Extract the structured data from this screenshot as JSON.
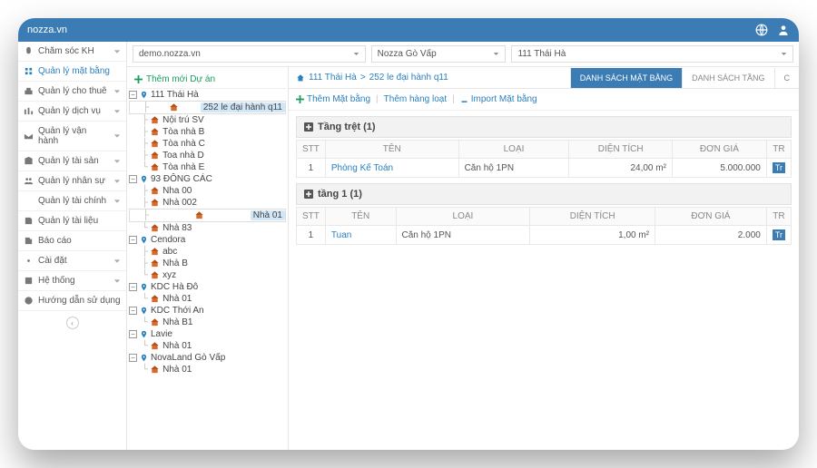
{
  "topbar": {
    "brand": "nozza.vn"
  },
  "sidebar": {
    "items": [
      {
        "label": "Chăm sóc KH",
        "chev": true
      },
      {
        "label": "Quản lý mặt bằng",
        "active": true
      },
      {
        "label": "Quản lý cho thuê",
        "chev": true
      },
      {
        "label": "Quản lý dịch vụ",
        "chev": true
      },
      {
        "label": "Quản lý vận hành",
        "chev": true
      },
      {
        "label": "Quản lý tài sản",
        "chev": true
      },
      {
        "label": "Quản lý nhân sự",
        "chev": true
      },
      {
        "label": "Quản lý tài chính",
        "chev": true
      },
      {
        "label": "Quản lý tài liệu"
      },
      {
        "label": "Báo cáo"
      },
      {
        "label": "Cài đặt",
        "chev": true
      },
      {
        "label": "Hệ thống",
        "chev": true
      },
      {
        "label": "Hướng dẫn sử dụng"
      }
    ]
  },
  "selects": {
    "domain": "demo.nozza.vn",
    "area": "Nozza Gò Vấp",
    "building": "111 Thái Hà"
  },
  "tree": {
    "add_project": "Thêm mới Dự án",
    "nodes": [
      {
        "name": "111 Thái Hà",
        "pin": true,
        "children": [
          {
            "name": "252 le đại hành q11",
            "selected": true
          },
          {
            "name": "Nội trú SV"
          },
          {
            "name": "Tòa nhà B"
          },
          {
            "name": "Tòa nhà C"
          },
          {
            "name": "Toa nhà D"
          },
          {
            "name": "Tòa nhà E"
          }
        ]
      },
      {
        "name": "93 ĐÔNG CÁC",
        "pin": true,
        "children": [
          {
            "name": "Nha 00"
          },
          {
            "name": "Nhà 002"
          },
          {
            "name": "Nhà 01",
            "selected": true
          },
          {
            "name": "Nhà 83"
          }
        ]
      },
      {
        "name": "Cendora",
        "pin": true,
        "children": [
          {
            "name": "abc"
          },
          {
            "name": "Nhà B"
          },
          {
            "name": "xyz"
          }
        ]
      },
      {
        "name": "KDC Hà Đô",
        "pin": true,
        "children": [
          {
            "name": "Nhà 01"
          }
        ]
      },
      {
        "name": "KDC Thới An",
        "pin": true,
        "children": [
          {
            "name": "Nhà B1"
          }
        ]
      },
      {
        "name": "Lavie",
        "pin": true,
        "children": [
          {
            "name": "Nhà 01"
          }
        ]
      },
      {
        "name": "NovaLand Gò Vấp",
        "pin": true,
        "children": [
          {
            "name": "Nhà 01"
          }
        ]
      }
    ]
  },
  "pathbar": {
    "crumb1": "111 Thái Hà",
    "crumb2": "252 le đại hành q11",
    "tabs": [
      "DANH SÁCH MẶT BẰNG",
      "DANH SÁCH TẦNG",
      "C"
    ]
  },
  "actions": {
    "add": "Thêm Mặt bằng",
    "bulk": "Thêm hàng loạt",
    "import": "Import Mặt bằng"
  },
  "sections": [
    {
      "title": "Tầng trệt (1)",
      "columns": [
        "STT",
        "TÊN",
        "LOẠI",
        "DIỆN TÍCH",
        "ĐƠN GIÁ",
        "TR"
      ],
      "rows": [
        {
          "stt": "1",
          "ten": "Phòng Kế Toán",
          "loai": "Căn hộ 1PN",
          "dt": "24,00 m²",
          "gia": "5.000.000",
          "tr": "Tr"
        }
      ]
    },
    {
      "title": "tầng 1 (1)",
      "columns": [
        "STT",
        "TÊN",
        "LOẠI",
        "DIỆN TÍCH",
        "ĐƠN GIÁ",
        "TR"
      ],
      "rows": [
        {
          "stt": "1",
          "ten": "Tuan",
          "loai": "Căn hộ 1PN",
          "dt": "1,00 m²",
          "gia": "2.000",
          "tr": "Tr"
        }
      ]
    }
  ]
}
